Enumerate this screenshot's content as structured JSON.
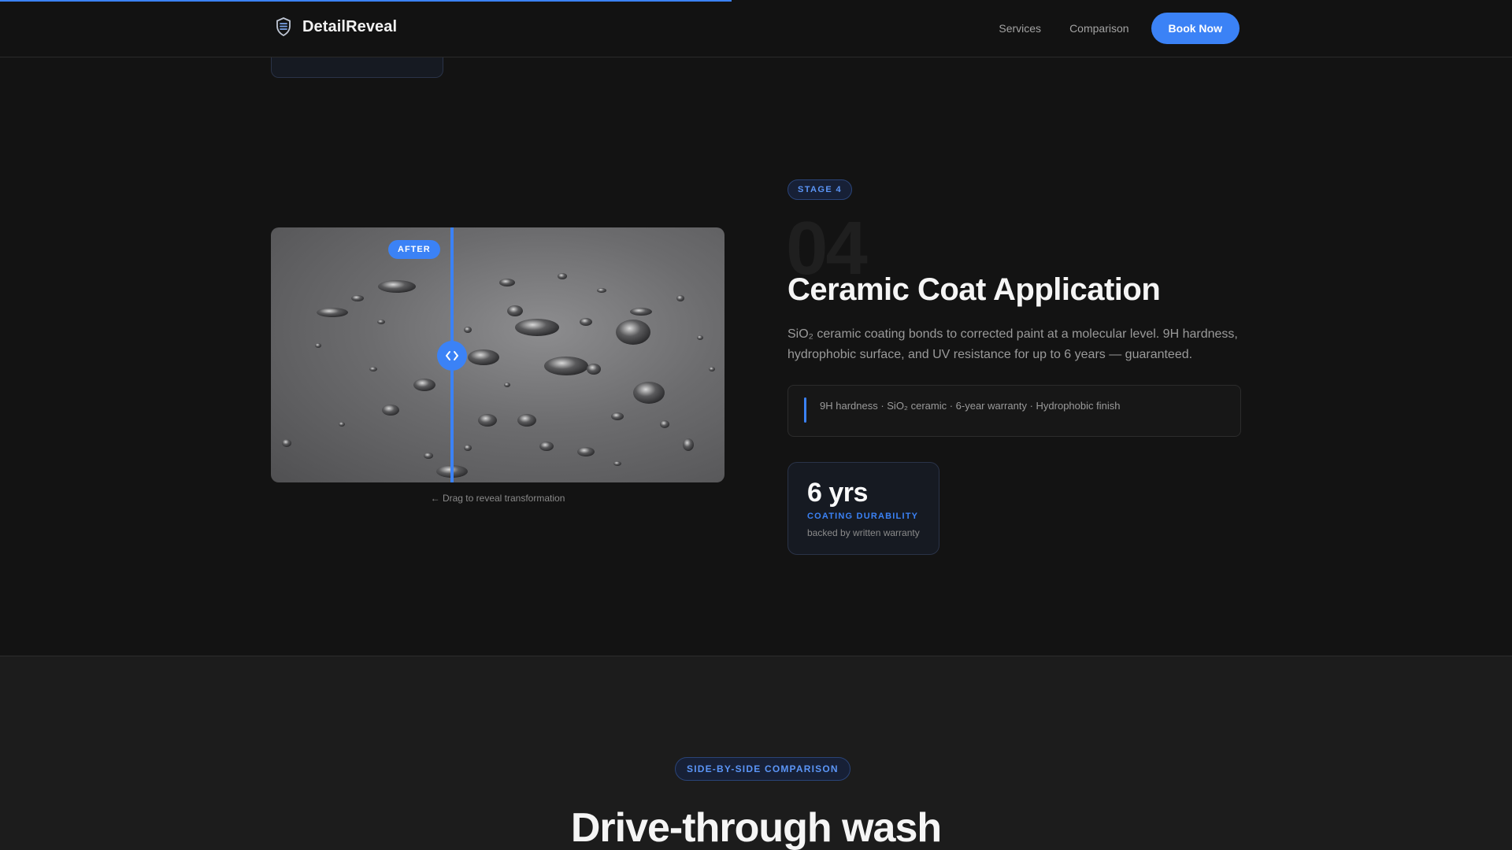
{
  "header": {
    "brand_name": "DetailReveal",
    "nav": {
      "services": "Services",
      "comparison": "Comparison",
      "book_now": "Book Now"
    }
  },
  "scroll_progress": 0.484,
  "stage": {
    "badge": "STAGE 4",
    "number": "04",
    "title": "Ceramic Coat Application",
    "description": "SiO₂ ceramic coating bonds to corrected paint at a molecular level. 9H hardness, hydrophobic surface, and UV resistance for up to 6 years — guaranteed.",
    "features": "9H hardness · SiO₂ ceramic · 6-year warranty · Hydrophobic finish",
    "stat": {
      "value": "6 yrs",
      "label": "COATING DURABILITY",
      "sub": "backed by written warranty"
    }
  },
  "slider": {
    "after_label": "AFTER",
    "drag_hint": "← Drag to reveal transformation",
    "position": 0.4
  },
  "comparison": {
    "badge": "SIDE-BY-SIDE COMPARISON",
    "heading": "Drive-through wash"
  },
  "colors": {
    "accent": "#3b82f6",
    "background": "#131313",
    "section_alt": "#1c1c1c"
  },
  "icons": {
    "brand": "shield-layers-icon",
    "handle": "drag-arrows-icon"
  }
}
